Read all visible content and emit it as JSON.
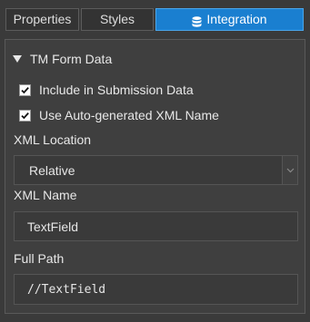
{
  "tabs": [
    {
      "label": "Properties",
      "active": false
    },
    {
      "label": "Styles",
      "active": false
    },
    {
      "label": "Integration",
      "active": true,
      "icon": "database-icon"
    }
  ],
  "section": {
    "title": "TM Form Data",
    "expanded": true
  },
  "checks": {
    "include_submission": {
      "label": "Include in Submission Data",
      "checked": true
    },
    "auto_xml_name": {
      "label": "Use Auto-generated XML Name",
      "checked": true
    }
  },
  "xml_location": {
    "label": "XML Location",
    "value": "Relative"
  },
  "xml_name": {
    "label": "XML Name",
    "value": "TextField"
  },
  "full_path": {
    "label": "Full Path",
    "value": "//TextField"
  },
  "colors": {
    "accent": "#1a7fd0",
    "background": "#3a3a3a",
    "text": "#e6e6e6"
  }
}
